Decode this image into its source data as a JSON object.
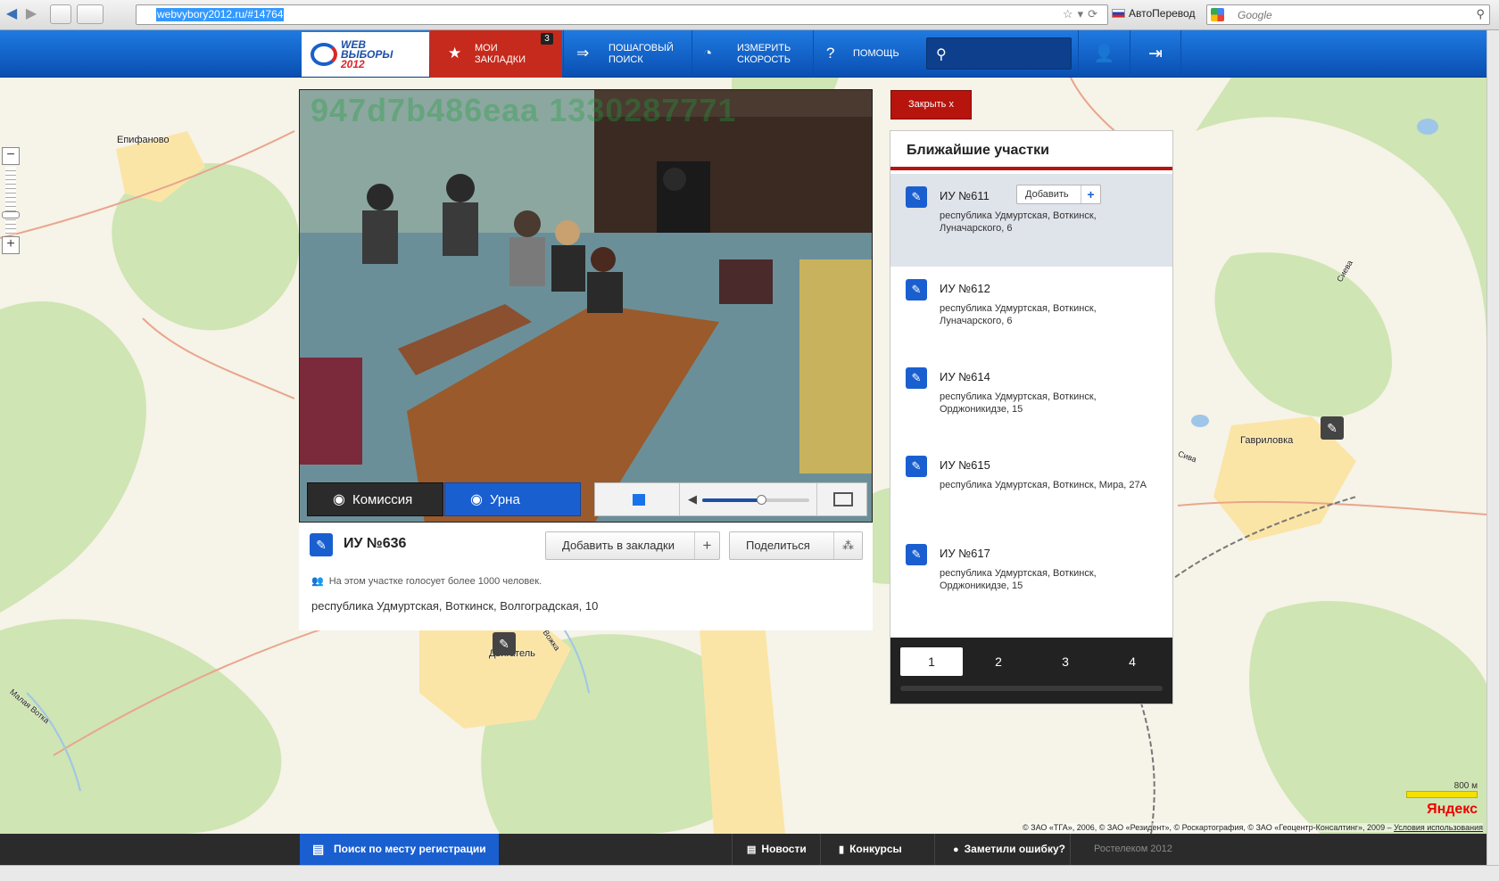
{
  "browser": {
    "url": "webvybory2012.ru/#14764",
    "translate_label": "АвтоПеревод",
    "search_placeholder": "Google"
  },
  "app_nav": {
    "logo_line1": "WEB",
    "logo_line2": "ВЫБОРЫ",
    "logo_line3": "2012",
    "bookmarks_label": "МОИ ЗАКЛАДКИ",
    "bookmarks_count": "3",
    "step_search_label": "ПОШАГОВЫЙ ПОИСК",
    "speed_label": "ИЗМЕРИТЬ СКОРОСТЬ",
    "help_label": "ПОМОЩЬ"
  },
  "map": {
    "labels": {
      "epifanovo": "Епифаново",
      "gavrilovka": "Гавриловка",
      "dvigatel": "Двигатель",
      "vozhka": "Вожка",
      "malaya_votka": "Малая Вотка",
      "sieva": "Сиева",
      "sivа2": "Сива"
    },
    "scale": "800 м",
    "provider": "Яндекс",
    "copyright_text": "© ЗАО «ТГА», 2006, © ЗАО «Резидент», © Роскартография, © ЗАО «Геоцентр-Консалтинг», 2009 –",
    "terms_link": "Условия использования"
  },
  "video": {
    "watermark": "947d7b486eaa 1330287771",
    "cam_commission_label": "Комиссия",
    "cam_urn_label": "Урна",
    "volume_level": 0.55
  },
  "station": {
    "title": "ИУ №636",
    "add_bookmark_label": "Добавить в закладки",
    "share_label": "Поделиться",
    "voters_note": "На этом участке голосует более 1000 человек.",
    "address": "республика Удмуртская, Воткинск, Волгоградская, 10"
  },
  "nearby": {
    "close_label": "Закрыть  x",
    "title": "Ближайшие участки",
    "add_label": "Добавить",
    "items": [
      {
        "name": "ИУ №611",
        "address": "республика Удмуртская, Воткинск, Луначарского, 6"
      },
      {
        "name": "ИУ №612",
        "address": "республика Удмуртская, Воткинск, Луначарского, 6"
      },
      {
        "name": "ИУ №614",
        "address": "республика Удмуртская, Воткинск, Орджоникидзе, 15"
      },
      {
        "name": "ИУ №615",
        "address": "республика Удмуртская, Воткинск, Мира, 27А"
      },
      {
        "name": "ИУ №617",
        "address": "республика Удмуртская, Воткинск, Орджоникидзе, 15"
      }
    ],
    "pages": [
      "1",
      "2",
      "3",
      "4"
    ],
    "current_page": "1"
  },
  "bottom": {
    "reg_search_label": "Поиск по месту регистрации",
    "news_label": "Новости",
    "contests_label": "Конкурсы",
    "error_label": "Заметили ошибку?",
    "copyright": "Ростелеком 2012"
  }
}
